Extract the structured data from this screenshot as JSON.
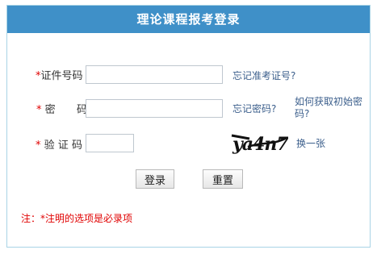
{
  "header": {
    "title": "理论课程报考登录"
  },
  "form": {
    "required_mark": "*",
    "id_label": "证件号码",
    "id_value": "",
    "password_label_a": "密",
    "password_label_b": "码",
    "password_value": "",
    "captcha_label_a": "验",
    "captcha_label_b": "证",
    "captcha_label_c": "码",
    "captcha_value": "",
    "captcha_text": "ya4n7"
  },
  "links": {
    "forgot_ticket": "忘记准考证号?",
    "forgot_password": "忘记密码?",
    "how_get_password": "如何获取初始密码?",
    "refresh_captcha": "换一张"
  },
  "buttons": {
    "login": "登录",
    "reset": "重置"
  },
  "note": "注：*注明的选项是必录项"
}
